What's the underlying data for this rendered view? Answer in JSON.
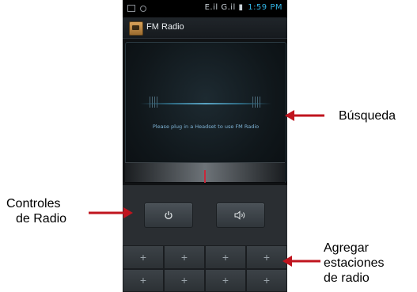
{
  "status_bar": {
    "indicators": "E.il G.il",
    "time": "1:59 PM"
  },
  "app_bar": {
    "icon": "radio-app-icon",
    "title": "FM Radio"
  },
  "display": {
    "message": "Please plug in a Headset to use FM Radio"
  },
  "controls": {
    "power_icon": "power-icon",
    "speaker_icon": "speaker-icon"
  },
  "presets": {
    "add_symbol": "+",
    "count": 8
  },
  "annotations": {
    "search": "Búsqueda",
    "radio_controls_line1": "Controles",
    "radio_controls_line2": "de Radio",
    "add_stations_line1": "Agregar",
    "add_stations_line2": "estaciones",
    "add_stations_line3": "de radio"
  },
  "colors": {
    "arrow": "#c0141e",
    "accent": "#33b5e5",
    "message": "#7fb4d6"
  }
}
